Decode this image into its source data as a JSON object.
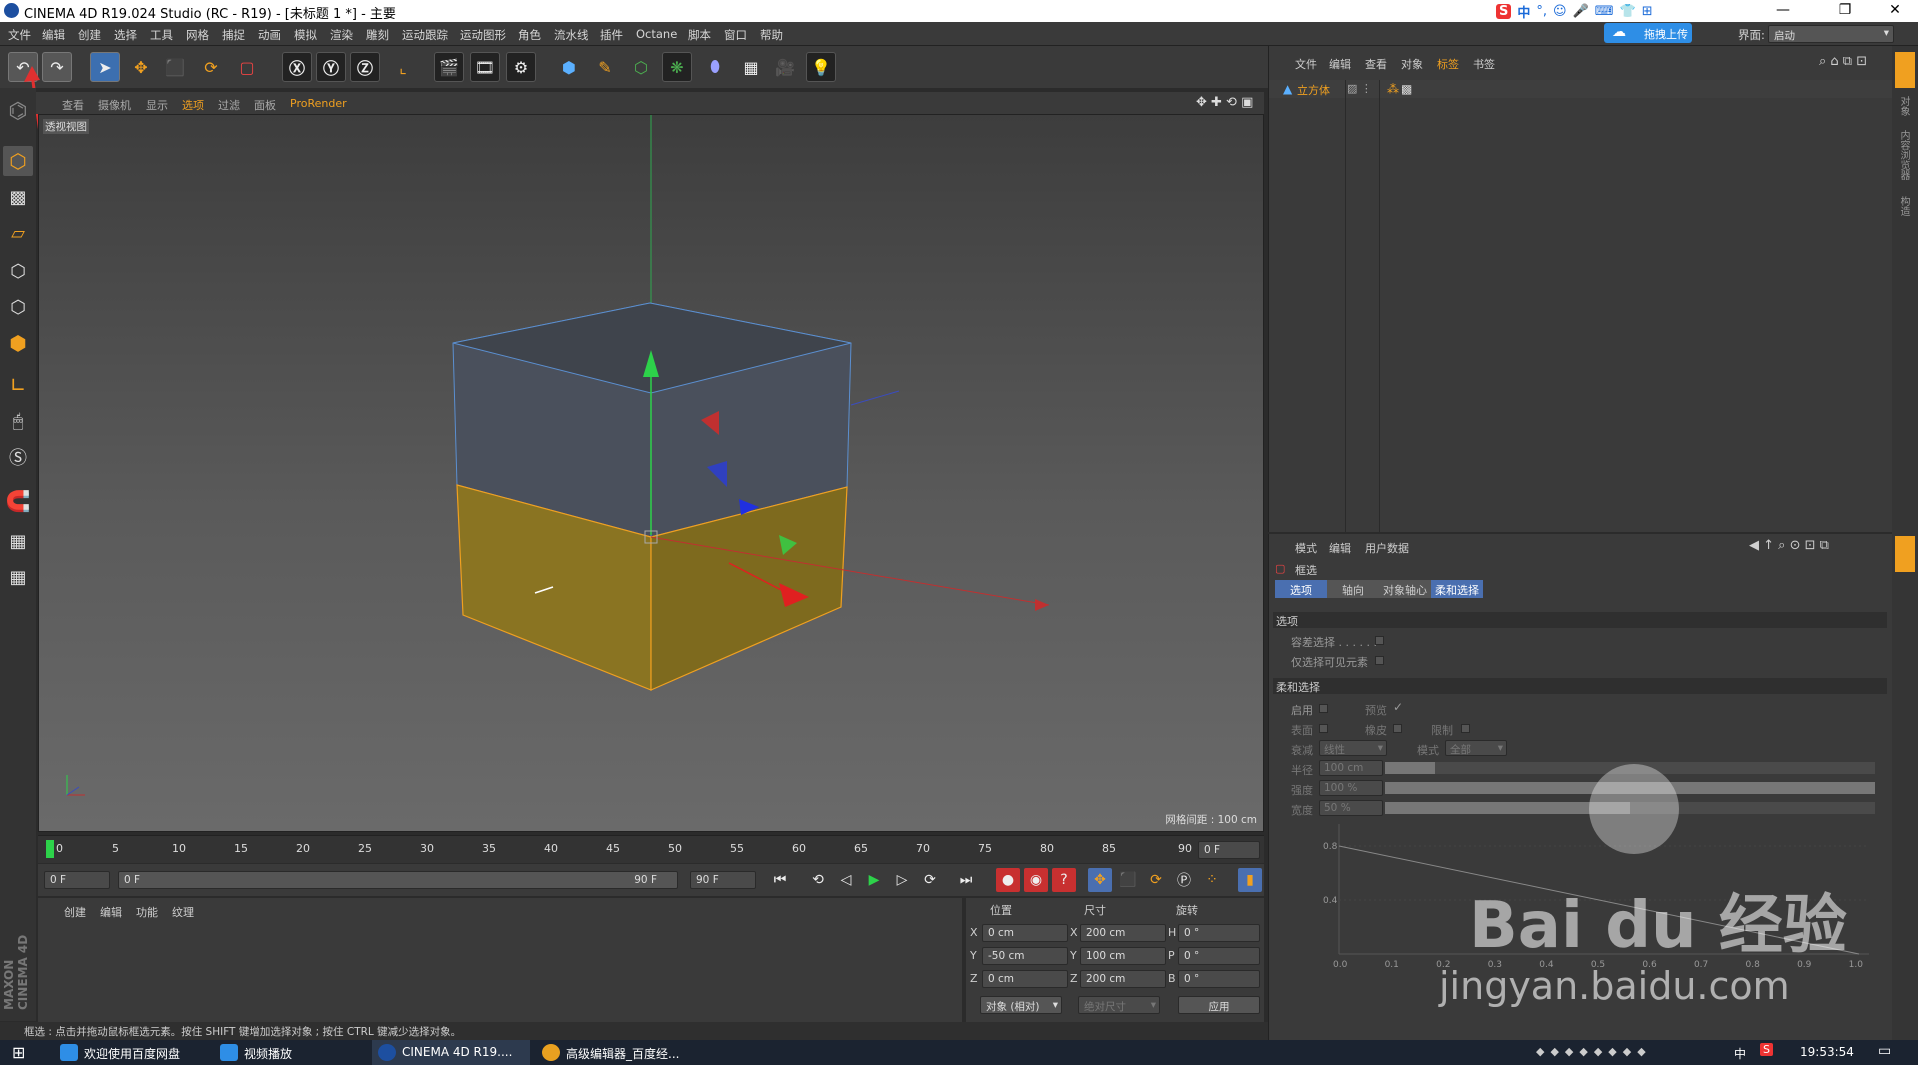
{
  "window": {
    "title": "CINEMA 4D R19.024 Studio (RC - R19) - [未标题 1 *] - 主要",
    "minimize": "—",
    "maximize": "❐",
    "close": "✕"
  },
  "menu": [
    "文件",
    "编辑",
    "创建",
    "选择",
    "工具",
    "网格",
    "捕捉",
    "动画",
    "模拟",
    "渲染",
    "雕刻",
    "运动跟踪",
    "运动图形",
    "角色",
    "流水线",
    "插件",
    "Octane",
    "脚本",
    "窗口",
    "帮助"
  ],
  "interface": {
    "label": "界面:",
    "value": "启动"
  },
  "upload_button": "拖拽上传",
  "ime": "中",
  "viewport": {
    "menu": [
      "查看",
      "摄像机",
      "显示",
      "选项",
      "过滤",
      "面板",
      "ProRender"
    ],
    "label": "透视视图",
    "grid": "网格间距 : 100 cm"
  },
  "timeline": {
    "ticks": [
      "0",
      "5",
      "10",
      "15",
      "20",
      "25",
      "30",
      "35",
      "40",
      "45",
      "50",
      "55",
      "60",
      "65",
      "70",
      "75",
      "80",
      "85",
      "90"
    ],
    "current": "0 F"
  },
  "transport": {
    "start": "0 F",
    "range_start": "0 F",
    "range_end": "90 F",
    "end": "90 F"
  },
  "materials": {
    "menu": [
      "创建",
      "编辑",
      "功能",
      "纹理"
    ]
  },
  "coords": {
    "headers": [
      "位置",
      "尺寸",
      "旋转"
    ],
    "rows": [
      {
        "axis": "X",
        "pos": "0 cm",
        "size_axis": "X",
        "size": "200 cm",
        "rot_axis": "H",
        "rot": "0 °"
      },
      {
        "axis": "Y",
        "pos": "-50 cm",
        "size_axis": "Y",
        "size": "100 cm",
        "rot_axis": "P",
        "rot": "0 °"
      },
      {
        "axis": "Z",
        "pos": "0 cm",
        "size_axis": "Z",
        "size": "200 cm",
        "rot_axis": "B",
        "rot": "0 °"
      }
    ],
    "mode": "对象 (相对)",
    "size_mode": "绝对尺寸",
    "apply": "应用"
  },
  "status": "框选 : 点击并拖动鼠标框选元素。按住 SHIFT 键增加选择对象 ; 按住 CTRL 键减少选择对象。",
  "object_manager": {
    "menu": [
      "文件",
      "编辑",
      "查看",
      "对象",
      "标签",
      "书签"
    ],
    "object": "立方体"
  },
  "attributes": {
    "menu": [
      "模式",
      "编辑",
      "用户数据"
    ],
    "tool": "框选",
    "tabs": [
      "选项",
      "轴向",
      "对象轴心",
      "柔和选择"
    ],
    "section_options": "选项",
    "tolerant": "容差选择 . . . . . .",
    "visible_only": "仅选择可见元素",
    "section_soft": "柔和选择",
    "enable": "启用",
    "preview": "预览",
    "surface": "表面",
    "rubber": "橡皮",
    "limit": "限制",
    "falloff": "衰减",
    "falloff_value": "线性",
    "mode": "模式",
    "mode_value": "全部",
    "radius": "半径",
    "radius_value": "100 cm",
    "strength": "强度",
    "strength_value": "100 %",
    "width": "宽度",
    "width_value": "50 %",
    "graph_y": [
      "0.8",
      "0.4"
    ],
    "graph_x": [
      "0.0",
      "0.1",
      "0.2",
      "0.3",
      "0.4",
      "0.5",
      "0.6",
      "0.7",
      "0.8",
      "0.9",
      "1.0"
    ]
  },
  "side_tabs": [
    "对象",
    "内容浏览器",
    "构造"
  ],
  "taskbar": {
    "items": [
      "欢迎使用百度网盘",
      "视频播放",
      "CINEMA 4D R19....",
      "高级编辑器_百度经..."
    ],
    "time": "19:53:54",
    "lang": "中"
  },
  "watermark": {
    "brand": "Bai du 经验",
    "url": "jingyan.baidu.com"
  },
  "maxon": "MAXON CINEMA 4D"
}
